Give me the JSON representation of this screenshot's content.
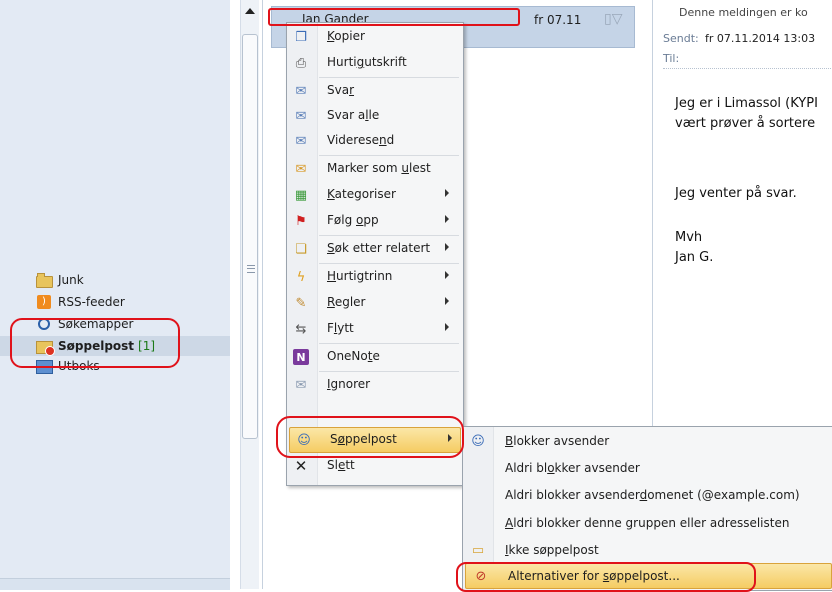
{
  "nav": {
    "folders": [
      {
        "label": "Junk",
        "icon": "folder-icon"
      },
      {
        "label": "RSS-feeder",
        "icon": "rss-icon"
      },
      {
        "label": "Søkemapper",
        "icon": "search-folder-icon"
      },
      {
        "label": "Søppelpost",
        "count": "[1]",
        "icon": "junk-email-folder-icon"
      },
      {
        "label": "Utboks",
        "icon": "outbox-icon"
      }
    ]
  },
  "message_list": {
    "row": {
      "sender": "Jan Gander",
      "date": "fr 07.11"
    }
  },
  "reading_pane": {
    "notice": "Denne meldingen er ko",
    "sent_label": "Sendt:",
    "sent_value": "fr 07.11.2014 13:03",
    "to_label": "Til:",
    "body_lines": [
      "Jeg er i Limassol (KYPI",
      "vært prøver å sortere",
      "Jeg venter på svar.",
      "Mvh",
      "Jan G."
    ]
  },
  "context_menu": {
    "items": [
      {
        "pre": "",
        "ul": "K",
        "post": "opier",
        "icon": "copy-icon",
        "submenu": false
      },
      {
        "pre": "Hurti",
        "ul": "g",
        "post": "utskrift",
        "icon": "print-icon",
        "submenu": false
      },
      {
        "pre": "Sva",
        "ul": "r",
        "post": "",
        "icon": "reply-icon",
        "submenu": false
      },
      {
        "pre": "Svar a",
        "ul": "l",
        "post": "le",
        "icon": "reply-all-icon",
        "submenu": false
      },
      {
        "pre": "Viderese",
        "ul": "n",
        "post": "d",
        "icon": "forward-icon",
        "submenu": false
      },
      {
        "pre": "Marker som ",
        "ul": "u",
        "post": "lest",
        "icon": "mark-unread-icon",
        "submenu": false
      },
      {
        "pre": "",
        "ul": "K",
        "post": "ategoriser",
        "icon": "categorize-icon",
        "submenu": true
      },
      {
        "pre": "Følg ",
        "ul": "o",
        "post": "pp",
        "icon": "flag-icon",
        "submenu": true
      },
      {
        "pre": "",
        "ul": "S",
        "post": "øk etter relatert",
        "icon": "find-related-icon",
        "submenu": true
      },
      {
        "pre": "",
        "ul": "H",
        "post": "urtigtrinn",
        "icon": "quick-steps-icon",
        "submenu": true
      },
      {
        "pre": "",
        "ul": "R",
        "post": "egler",
        "icon": "rules-icon",
        "submenu": true
      },
      {
        "pre": "F",
        "ul": "l",
        "post": "ytt",
        "icon": "move-icon",
        "submenu": true
      },
      {
        "pre": "OneNo",
        "ul": "t",
        "post": "e",
        "icon": "onenote-icon",
        "submenu": false
      },
      {
        "pre": "",
        "ul": "I",
        "post": "gnorer",
        "icon": "ignore-icon",
        "submenu": false
      },
      {
        "pre": "S",
        "ul": "ø",
        "post": "ppelpost",
        "icon": "junk-icon",
        "submenu": true
      },
      {
        "pre": "Sl",
        "ul": "e",
        "post": "tt",
        "icon": "delete-icon",
        "submenu": false
      }
    ]
  },
  "junk_submenu": {
    "items": [
      {
        "pre": "",
        "ul": "B",
        "post": "lokker avsender",
        "icon": "block-sender-icon"
      },
      {
        "pre": "Aldri bl",
        "ul": "o",
        "post": "kker avsender",
        "icon": ""
      },
      {
        "pre": "Aldri blokker avsender",
        "ul": "d",
        "post": "omenet (@example.com)",
        "icon": ""
      },
      {
        "pre": "",
        "ul": "A",
        "post": "ldri blokker denne gruppen eller adresselisten",
        "icon": ""
      },
      {
        "pre": "",
        "ul": "I",
        "post": "kke søppelpost",
        "icon": "not-junk-icon"
      },
      {
        "pre": "Alternativer for ",
        "ul": "s",
        "post": "øppelpost...",
        "icon": "junk-options-icon"
      }
    ]
  },
  "colors": {
    "annotation": "#e0121a",
    "highlight": "#f5cc63",
    "selection": "#c5d4e7"
  }
}
